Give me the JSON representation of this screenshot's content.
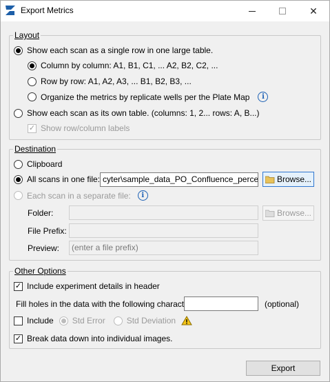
{
  "window": {
    "title": "Export Metrics",
    "controls": {
      "minimize": "–",
      "maximize": "□",
      "close": "✕"
    }
  },
  "layout": {
    "legend": "Layout",
    "single_table": "Show each scan as a single row in one large table.",
    "column_by_column": "Column by column: A1, B1, C1, ... A2, B2, C2, ...",
    "row_by_row": "Row by row: A1, A2,  A3, ... B1, B2, B3, ...",
    "replicate": "Organize the metrics by replicate wells per the Plate Map",
    "own_table": "Show each scan as its own table.  (columns: 1, 2...  rows: A, B...)",
    "show_labels": "Show row/column labels"
  },
  "destination": {
    "legend": "Destination",
    "clipboard": "Clipboard",
    "one_file": "All scans in one file:",
    "one_file_path": "cyter\\sample_data_PO_Confluence_percent.txt",
    "browse": "Browse...",
    "separate": "Each scan in a separate file:",
    "folder_label": "Folder:",
    "prefix_label": "File Prefix:",
    "preview_label": "Preview:",
    "preview_placeholder": "(enter a file prefix)",
    "browse2": "Browse..."
  },
  "other": {
    "legend": "Other Options",
    "include_details": "Include experiment details in header",
    "fill_holes": "Fill holes in the data with the following characters:",
    "optional": "(optional)",
    "include": "Include",
    "std_error": "Std Error",
    "std_dev": "Std Deviation",
    "break_data": "Break data down into individual images."
  },
  "footer": {
    "export": "Export"
  },
  "state": {
    "layout_mode": "single_table",
    "order": "column_by_column",
    "show_labels": true,
    "destination": "one_file",
    "include_details": true,
    "include": false,
    "break_data": true
  },
  "icons": [
    "app-icon",
    "info-icon",
    "folder-icon",
    "warning-icon"
  ]
}
